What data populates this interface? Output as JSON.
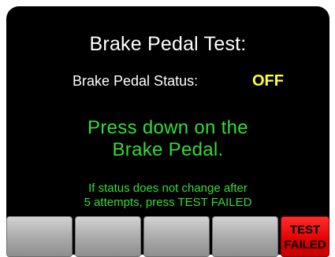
{
  "screen": {
    "title": "Brake Pedal Test:",
    "status_label": "Brake Pedal Status:",
    "status_value": "OFF",
    "instruction_line1": "Press down on the",
    "instruction_line2": "Brake Pedal.",
    "hint_line1": "If status does not change after",
    "hint_line2": "5 attempts, press TEST FAILED"
  },
  "buttons": {
    "test_failed_line1": "TEST",
    "test_failed_line2": "FAILED"
  },
  "colors": {
    "background": "#000000",
    "title_text": "#ffffff",
    "status_value": "#ffff33",
    "instruction_text": "#33dd33",
    "fail_button": "#e00000",
    "blank_button": "#a9a9a9"
  }
}
